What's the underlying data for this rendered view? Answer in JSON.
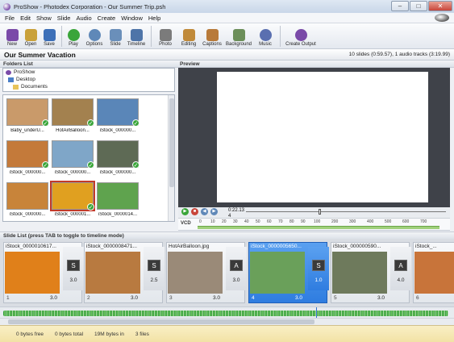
{
  "window": {
    "title": "ProShow - Photodex Corporation - Our Summer Trip.psh",
    "min": "–",
    "max": "□",
    "close": "✕"
  },
  "menu": [
    "File",
    "Edit",
    "Show",
    "Slide",
    "Audio",
    "Create",
    "Window",
    "Help"
  ],
  "toolbar": [
    {
      "label": "New",
      "color": "#7a4aa8"
    },
    {
      "label": "Open",
      "color": "#c9a13a"
    },
    {
      "label": "Save",
      "color": "#3c6fb8"
    },
    {
      "label": "Play",
      "color": "#3aa53a"
    },
    {
      "label": "Options",
      "color": "#5f88b8"
    },
    {
      "label": "Slide",
      "color": "#6a8fba"
    },
    {
      "label": "Timeline",
      "color": "#4e74a8"
    },
    {
      "label": "Photo",
      "color": "#7b7b7b"
    },
    {
      "label": "Editing",
      "color": "#c08a3a"
    },
    {
      "label": "Captions",
      "color": "#b87a3a"
    },
    {
      "label": "Background",
      "color": "#6c8f5a"
    },
    {
      "label": "Music",
      "color": "#5a6fb0"
    },
    {
      "label": "Create Output",
      "color": "#7a4aa8"
    }
  ],
  "project": {
    "title": "Our Summer Vacation",
    "info": "10 slides (0:59.57), 1 audio tracks (3:19.99)"
  },
  "folders": {
    "header": "Folders List",
    "items": [
      "ProShow",
      "Desktop",
      "Documents"
    ]
  },
  "preview": {
    "header": "Preview",
    "time": "0:22.13",
    "time_sub": "4",
    "format": "VCD"
  },
  "ruler_ticks": [
    "0",
    "10",
    "20",
    "30",
    "40",
    "50",
    "60",
    "70",
    "80",
    "90",
    "100",
    "200",
    "300",
    "400",
    "500",
    "600",
    "700"
  ],
  "thumbnails": [
    {
      "name": "Baby_underU...",
      "color": "#c99a6a",
      "checked": true
    },
    {
      "name": "HotAirBalloon...",
      "color": "#a3814f",
      "checked": true
    },
    {
      "name": "iStock_000000...",
      "color": "#5a86b8",
      "checked": true
    },
    {
      "name": "iStock_000000...",
      "color": "#c47a3a",
      "checked": true
    },
    {
      "name": "iStock_000000...",
      "color": "#7fa6c8",
      "checked": true
    },
    {
      "name": "iStock_000000...",
      "color": "#5e6a55",
      "checked": true
    },
    {
      "name": "iStock_000000...",
      "color": "#c8843a",
      "checked": false
    },
    {
      "name": "iStock_000001...",
      "color": "#e0a020",
      "checked": true
    },
    {
      "name": "iStock_0000014...",
      "color": "#5fa34e",
      "checked": false
    }
  ],
  "slidelist": {
    "header": "Slide List (press TAB to toggle to timeline mode)",
    "slides": [
      {
        "name": "iStock_0000010617...",
        "num": "1",
        "dur": "3.0",
        "color": "#e0801a"
      },
      {
        "name": "iStock_0000008471...",
        "num": "2",
        "dur": "3.0",
        "color": "#b87a40"
      },
      {
        "name": "HotAirBalloon.jpg",
        "num": "3",
        "dur": "3.0",
        "color": "#9a8a78"
      },
      {
        "name": "iStock_0000005650...",
        "num": "4",
        "dur": "3.0",
        "color": "#6aa05a"
      },
      {
        "name": "iStock_000000590...",
        "num": "5",
        "dur": "3.0",
        "color": "#6e7a5c"
      },
      {
        "name": "iStock_...",
        "num": "6",
        "dur": "",
        "color": "#c8743a"
      }
    ],
    "transitions": [
      {
        "dur": "3.0",
        "glyph": "S"
      },
      {
        "dur": "2.5",
        "glyph": "S"
      },
      {
        "dur": "3.0",
        "glyph": "A"
      },
      {
        "dur": "1.0",
        "glyph": "S"
      },
      {
        "dur": "4.0",
        "glyph": "A"
      }
    ]
  },
  "status": [
    "0 bytes free",
    "0 bytes total",
    "19M bytes in",
    "3 files"
  ]
}
